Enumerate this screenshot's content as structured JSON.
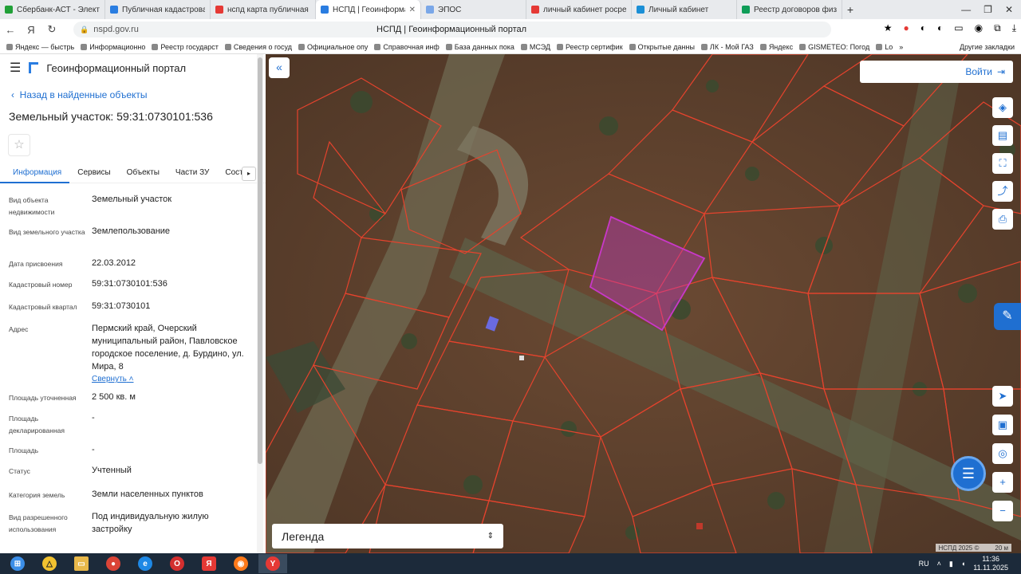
{
  "browser": {
    "tabs": [
      {
        "title": "Сбербанк-АСТ - Электро",
        "color": "#21a038"
      },
      {
        "title": "Публичная кадастровая",
        "color": "#2a7de1"
      },
      {
        "title": "нспд карта публичная ка",
        "color": "#e53935"
      },
      {
        "title": "НСПД | Геоинформац",
        "color": "#2a7de1"
      },
      {
        "title": "ЭПОС",
        "color": "#7aa7e8"
      },
      {
        "title": "личный кабинет росреес",
        "color": "#e53935"
      },
      {
        "title": "Личный кабинет",
        "color": "#1b8fd6"
      },
      {
        "title": "Реестр договоров физл",
        "color": "#0f9d58"
      }
    ],
    "url": "nspd.gov.ru",
    "page_title": "НСПД | Геоинформационный портал",
    "bookmarks": [
      "Яндекс — быстрь",
      "Информационно",
      "Реестр государст",
      "Сведения о госуд",
      "Официальное опу",
      "Справочная инф",
      "База данных пока",
      "МСЭД",
      "Реестр сертифик",
      "Открытые данны",
      "ЛК - Мой ГАЗ",
      "Яндекс",
      "GISMETEO: Погод",
      "Lo"
    ],
    "other_bookmarks": "Другие закладки"
  },
  "sidebar": {
    "portal_title": "Геоинформационный портал",
    "back_link": "Назад в найденные объекты",
    "object_title": "Земельный участок: 59:31:0730101:536",
    "tabs": [
      "Информация",
      "Сервисы",
      "Объекты",
      "Части ЗУ",
      "Соста"
    ],
    "attributes": [
      {
        "label": "Вид объекта недвижимости",
        "value": "Земельный участок"
      },
      {
        "label": "Вид земельного участка",
        "value": "Землепользование"
      },
      {
        "label": "Дата присвоения",
        "value": "22.03.2012"
      },
      {
        "label": "Кадастровый номер",
        "value": "59:31:0730101:536"
      },
      {
        "label": "Кадастровый квартал",
        "value": "59:31:0730101"
      },
      {
        "label": "Адрес",
        "value": "Пермский край, Очерский муниципальный район, Павловское городское поселение, д. Бурдино, ул. Мира, 8"
      },
      {
        "label": "Площадь уточненная",
        "value": "2 500 кв. м"
      },
      {
        "label": "Площадь декларированная",
        "value": "-"
      },
      {
        "label": "Площадь",
        "value": "-"
      },
      {
        "label": "Статус",
        "value": "Учтенный"
      },
      {
        "label": "Категория земель",
        "value": "Земли населенных пунктов"
      },
      {
        "label": "Вид разрешенного использования",
        "value": "Под индивидуальную жилую застройку"
      }
    ],
    "collapse_link": "Свернуть"
  },
  "map": {
    "login_label": "Войти",
    "legend_label": "Легенда",
    "copyright": "НСПД 2025 ©",
    "scale_label": "20 м",
    "parcel_color": "#c838c8",
    "boundary_color": "#e5432d"
  },
  "taskbar": {
    "lang": "RU",
    "time": "11:36",
    "date": "11.11.2025"
  }
}
